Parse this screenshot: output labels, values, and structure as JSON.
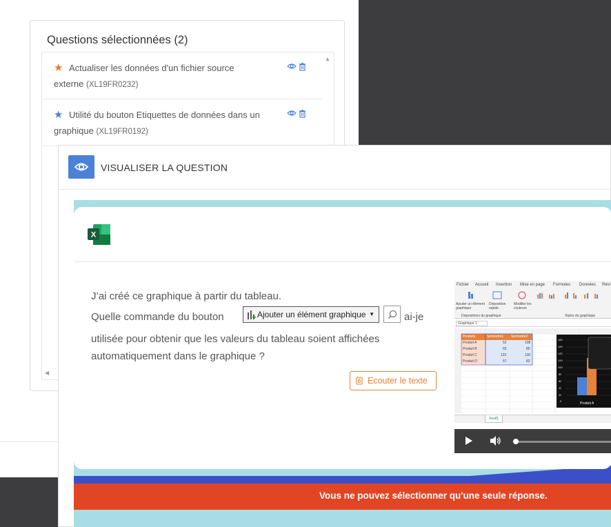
{
  "selected_panel": {
    "title": "Questions sélectionnées (2)",
    "items": [
      {
        "text": "Actualiser les données d'un fichier source externe",
        "code": "(XL19FR0232)",
        "star_color": "#e87b2e"
      },
      {
        "text": "Utilité du bouton Etiquettes de données dans un graphique",
        "code": "(XL19FR0192)",
        "star_color": "#4a82d8"
      }
    ]
  },
  "modal": {
    "title": "VISUALISER LA QUESTION",
    "question": {
      "line1": "J’ai créé ce graphique à partir du tableau.",
      "line2_prefix": "Quelle commande du bouton",
      "command_button": "Ajouter un élément graphique",
      "line2_suffix": "ai-je",
      "line3": "utilisée pour obtenir que les valeurs du tableau soient affichées",
      "line4": "automatiquement dans le graphique ?"
    },
    "listen_button": "Ecouter le texte",
    "banner": "Vous ne pouvez sélectionner qu'une seule réponse.",
    "video": {
      "ribbon_tabs": [
        "Fichier",
        "Accueil",
        "Insertion",
        "Mise en page",
        "Formules",
        "Données",
        "Révi"
      ],
      "ribbon_labels": {
        "add_element": "Ajouter un élément graphique",
        "quick_layout": "Disposition rapide",
        "modify_colors": "Modifier les couleurs",
        "group_layouts": "Dispositions du graphique",
        "group_styles": "Styles du graphique"
      },
      "name_box": "Graphique 1",
      "table": {
        "header": [
          "Produits",
          "Semestre1",
          "Semestre2"
        ],
        "rows": [
          [
            "Produit A",
            "52",
            "108"
          ],
          [
            "Produit B",
            "65",
            "85"
          ],
          [
            "Produit C",
            "123",
            "130"
          ],
          [
            "Produit D",
            "57",
            "82"
          ]
        ]
      },
      "chart_axis": [
        "180",
        "160",
        "140",
        "120",
        "100",
        "80",
        "60",
        "40",
        "20",
        "0"
      ],
      "chart_label": "Produit A",
      "sheet_tab": "Feuil1"
    }
  },
  "colors": {
    "accent_blue": "#4a82d8",
    "orange": "#e6823a",
    "banner_red": "#e24524",
    "stage_teal": "#a8dde5",
    "excel_green": "#217346"
  }
}
